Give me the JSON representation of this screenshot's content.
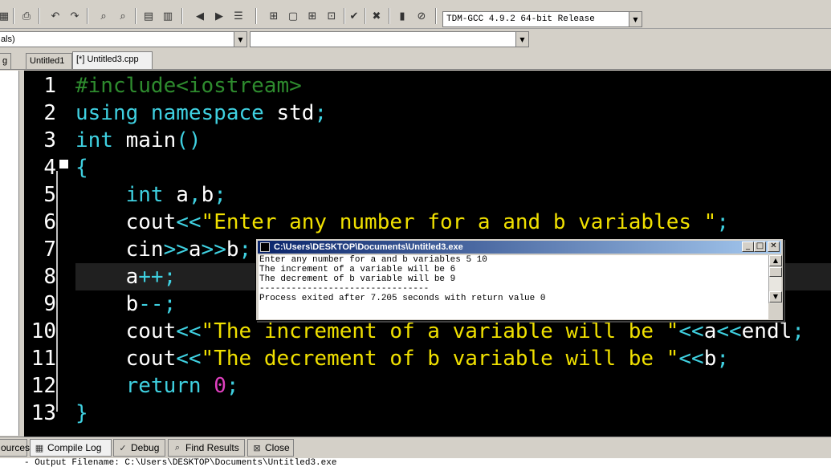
{
  "toolbar": {
    "compiler": "TDM-GCC 4.9.2 64-bit Release"
  },
  "combos": {
    "class_combo": "als)",
    "member_combo": ""
  },
  "tabs": {
    "left_stub": "g",
    "items": [
      "Untitled1",
      "[*] Untitled3.cpp"
    ]
  },
  "editor": {
    "lines": [
      {
        "n": "1",
        "tokens": [
          {
            "t": "#include<iostream>",
            "c": "c-pp"
          }
        ]
      },
      {
        "n": "2",
        "tokens": [
          {
            "t": "using namespace",
            "c": "c-kw"
          },
          {
            "t": " std",
            "c": "c-tx"
          },
          {
            "t": ";",
            "c": "c-op"
          }
        ]
      },
      {
        "n": "3",
        "tokens": [
          {
            "t": "int",
            "c": "c-kw"
          },
          {
            "t": " main",
            "c": "c-tx"
          },
          {
            "t": "()",
            "c": "c-op"
          }
        ]
      },
      {
        "n": "4",
        "tokens": [
          {
            "t": "{",
            "c": "c-op"
          }
        ]
      },
      {
        "n": "5",
        "tokens": [
          {
            "t": "    ",
            "c": "c-tx"
          },
          {
            "t": "int",
            "c": "c-kw"
          },
          {
            "t": " a",
            "c": "c-tx"
          },
          {
            "t": ",",
            "c": "c-op"
          },
          {
            "t": "b",
            "c": "c-tx"
          },
          {
            "t": ";",
            "c": "c-op"
          }
        ]
      },
      {
        "n": "6",
        "tokens": [
          {
            "t": "    cout",
            "c": "c-tx"
          },
          {
            "t": "<<",
            "c": "c-op"
          },
          {
            "t": "\"Enter any number for a and b variables \"",
            "c": "c-st"
          },
          {
            "t": ";",
            "c": "c-op"
          }
        ]
      },
      {
        "n": "7",
        "tokens": [
          {
            "t": "    cin",
            "c": "c-tx"
          },
          {
            "t": ">>",
            "c": "c-op"
          },
          {
            "t": "a",
            "c": "c-tx"
          },
          {
            "t": ">>",
            "c": "c-op"
          },
          {
            "t": "b",
            "c": "c-tx"
          },
          {
            "t": ";",
            "c": "c-op"
          }
        ]
      },
      {
        "n": "8",
        "tokens": [
          {
            "t": "    a",
            "c": "c-tx"
          },
          {
            "t": "++;",
            "c": "c-op"
          }
        ],
        "highlight": true
      },
      {
        "n": "9",
        "tokens": [
          {
            "t": "    b",
            "c": "c-tx"
          },
          {
            "t": "--;",
            "c": "c-op"
          }
        ]
      },
      {
        "n": "10",
        "tokens": [
          {
            "t": "    cout",
            "c": "c-tx"
          },
          {
            "t": "<<",
            "c": "c-op"
          },
          {
            "t": "\"The increment of a variable will be \"",
            "c": "c-st"
          },
          {
            "t": "<<",
            "c": "c-op"
          },
          {
            "t": "a",
            "c": "c-tx"
          },
          {
            "t": "<<",
            "c": "c-op"
          },
          {
            "t": "endl",
            "c": "c-tx"
          },
          {
            "t": ";",
            "c": "c-op"
          }
        ]
      },
      {
        "n": "11",
        "tokens": [
          {
            "t": "    cout",
            "c": "c-tx"
          },
          {
            "t": "<<",
            "c": "c-op"
          },
          {
            "t": "\"The decrement of b variable will be \"",
            "c": "c-st"
          },
          {
            "t": "<<",
            "c": "c-op"
          },
          {
            "t": "b",
            "c": "c-tx"
          },
          {
            "t": ";",
            "c": "c-op"
          }
        ]
      },
      {
        "n": "12",
        "tokens": [
          {
            "t": "    ",
            "c": "c-tx"
          },
          {
            "t": "return",
            "c": "c-kw"
          },
          {
            "t": " ",
            "c": "c-tx"
          },
          {
            "t": "0",
            "c": "c-nm"
          },
          {
            "t": ";",
            "c": "c-op"
          }
        ]
      },
      {
        "n": "13",
        "tokens": [
          {
            "t": "}",
            "c": "c-op"
          }
        ]
      }
    ]
  },
  "console": {
    "title": "C:\\Users\\DESKTOP\\Documents\\Untitled3.exe",
    "lines": [
      "Enter any number for a and b variables 5 10",
      "The increment of a variable will be 6",
      "The decrement of b variable will be 9",
      "--------------------------------",
      "Process exited after 7.205 seconds with return value 0"
    ]
  },
  "bottom_tabs": {
    "resources": "ources",
    "compile_log": "Compile Log",
    "debug": "Debug",
    "find_results": "Find Results",
    "close": "Close"
  },
  "output": {
    "line": "- Output Filename: C:\\Users\\DESKTOP\\Documents\\Untitled3.exe"
  },
  "colors": {
    "editor_bg": "#000000",
    "preprocessor": "#2e8b2e",
    "keyword": "#3fd0e0",
    "string": "#f0e000",
    "number": "#e040c0"
  }
}
